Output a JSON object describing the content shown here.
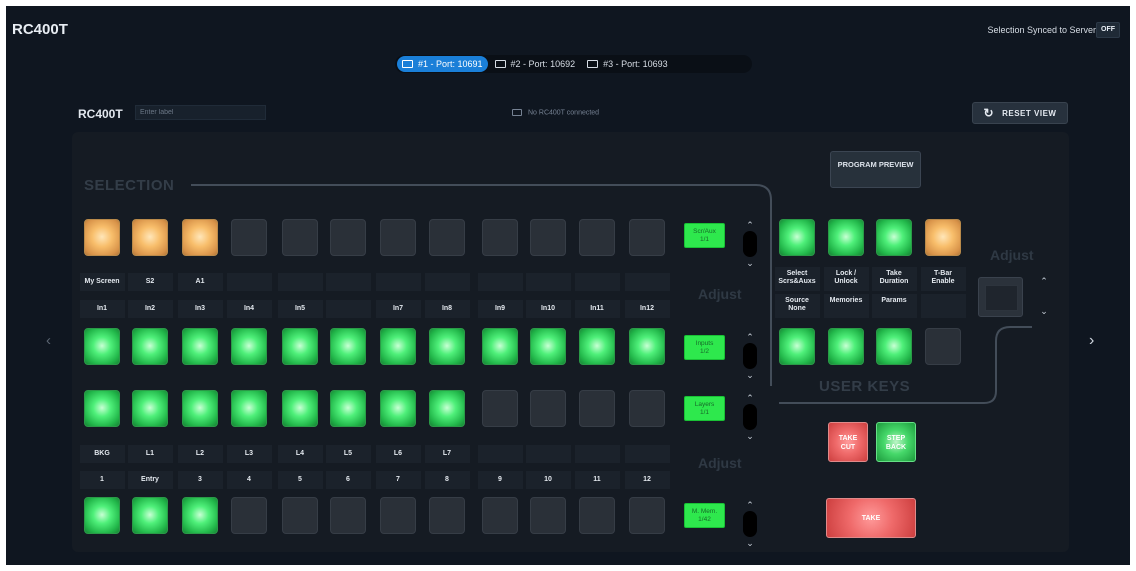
{
  "app": {
    "title": "RC400T",
    "sync_label": "Selection Synced to Server",
    "sync_toggle": "OFF"
  },
  "ports": [
    {
      "label": "#1 - Port: 10691",
      "active": true
    },
    {
      "label": "#2 - Port: 10692",
      "active": false
    },
    {
      "label": "#3 - Port: 10693",
      "active": false
    }
  ],
  "device": {
    "title": "RC400T",
    "label_placeholder": "Enter label",
    "status": "No RC400T connected",
    "reset_label": "RESET VIEW"
  },
  "panel": {
    "selection_title": "SELECTION",
    "user_keys_title": "USER KEYS",
    "adjust_labels": [
      "Adjust",
      "Adjust",
      "Adjust"
    ],
    "program_preview": "PROGRAM PREVIEW",
    "row1_keys": [
      "orange",
      "orange",
      "orange",
      "off",
      "off",
      "off",
      "off",
      "off",
      "off",
      "off",
      "off",
      "off"
    ],
    "row1_top_labels": [
      "My Screen",
      "S2",
      "A1",
      "",
      "",
      "",
      "",
      "",
      "",
      "",
      "",
      ""
    ],
    "row1_bottom_labels": [
      "In1",
      "In2",
      "In3",
      "In4",
      "In5",
      "",
      "In7",
      "In8",
      "In9",
      "In10",
      "In11",
      "In12"
    ],
    "row2_keys": [
      "green",
      "green",
      "green",
      "green",
      "green",
      "green",
      "green",
      "green",
      "green",
      "green",
      "green",
      "green"
    ],
    "row3_keys": [
      "green",
      "green",
      "green",
      "green",
      "green",
      "green",
      "green",
      "green",
      "off",
      "off",
      "off",
      "off"
    ],
    "row3_top_labels": [
      "BKG",
      "L1",
      "L2",
      "L3",
      "L4",
      "L5",
      "L6",
      "L7",
      "",
      "",
      "",
      ""
    ],
    "row3_bottom_labels": [
      "1",
      "Entry",
      "3",
      "4",
      "5",
      "6",
      "7",
      "8",
      "9",
      "10",
      "11",
      "12"
    ],
    "row4_keys": [
      "green",
      "green",
      "green",
      "off",
      "off",
      "off",
      "off",
      "off",
      "off",
      "off",
      "off",
      "off"
    ],
    "modes": [
      {
        "line1": "Scr/Aux",
        "line2": "1/1"
      },
      {
        "line1": "Inputs",
        "line2": "1/2"
      },
      {
        "line1": "Layers",
        "line2": "1/1"
      },
      {
        "line1": "M. Mem.",
        "line2": "1/42"
      }
    ],
    "user_row1_keys": [
      "green",
      "green",
      "green",
      "orange"
    ],
    "user_row1_labels": [
      {
        "line1": "Select",
        "line2": "Scrs&Auxs"
      },
      {
        "line1": "Lock /",
        "line2": "Unlock"
      },
      {
        "line1": "Take",
        "line2": "Duration"
      },
      {
        "line1": "T-Bar",
        "line2": "Enable"
      }
    ],
    "user_row2_labels": [
      {
        "line1": "Source",
        "line2": "None"
      },
      {
        "line1": "Memories",
        "line2": ""
      },
      {
        "line1": "Params",
        "line2": ""
      },
      {
        "line1": "",
        "line2": ""
      }
    ],
    "user_row2_keys": [
      "green",
      "green",
      "green",
      "off"
    ],
    "take_cut": {
      "line1": "TAKE",
      "line2": "CUT"
    },
    "step_back": {
      "line1": "STEP",
      "line2": "BACK"
    },
    "take": "TAKE"
  },
  "colors": {
    "background": "#0f1620",
    "accent_blue": "#1a7fd8",
    "key_green": "#3fe06a",
    "key_orange": "#f2b062",
    "take_red": "#e85b5b",
    "mode_green": "#2ee84d"
  },
  "icons": {
    "port": "monitor-icon",
    "reset": "refresh-icon",
    "prev": "chevron-left-icon",
    "next": "chevron-right-icon",
    "stepper_up": "chevron-up-icon",
    "stepper_down": "chevron-down-icon"
  }
}
